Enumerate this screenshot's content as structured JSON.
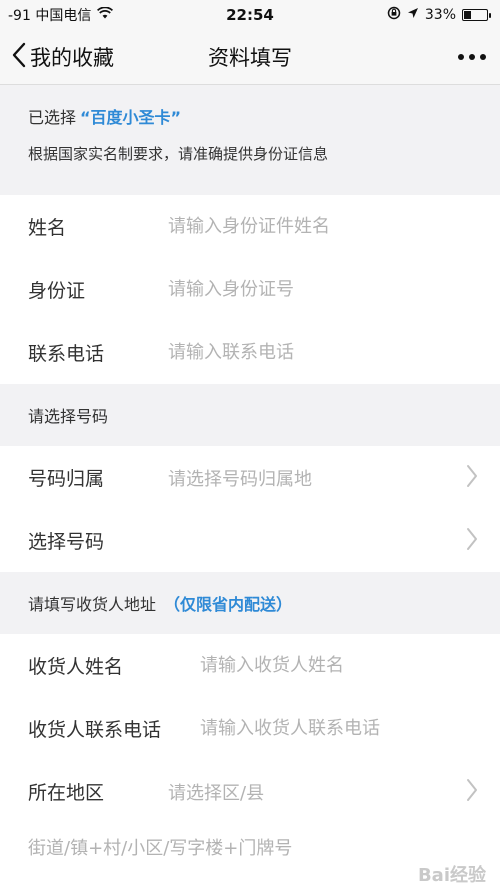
{
  "status_bar": {
    "carrier": "-91 中国电信",
    "time": "22:54",
    "battery": "33%",
    "battery_level": 0.33
  },
  "nav": {
    "back_label": "我的收藏",
    "title": "资料填写"
  },
  "info": {
    "selected_prefix": "已选择",
    "selected_item": "“百度小圣卡”",
    "notice": "根据国家实名制要求，请准确提供身份证信息"
  },
  "identity_form": {
    "name_label": "姓名",
    "name_placeholder": "请输入身份证件姓名",
    "id_label": "身份证",
    "id_placeholder": "请输入身份证号",
    "phone_label": "联系电话",
    "phone_placeholder": "请输入联系电话"
  },
  "number_section": {
    "header": "请选择号码",
    "region_label": "号码归属",
    "region_placeholder": "请选择号码归属地",
    "number_label": "选择号码"
  },
  "address_section": {
    "header": "请填写收货人地址",
    "header_note": "（仅限省内配送）",
    "receiver_name_label": "收货人姓名",
    "receiver_name_placeholder": "请输入收货人姓名",
    "receiver_phone_label": "收货人联系电话",
    "receiver_phone_placeholder": "请输入收货人联系电话",
    "area_label": "所在地区",
    "area_placeholder": "请选择区/县",
    "street_placeholder": "街道/镇+村/小区/写字楼+门牌号"
  },
  "watermark": "Bai经验"
}
